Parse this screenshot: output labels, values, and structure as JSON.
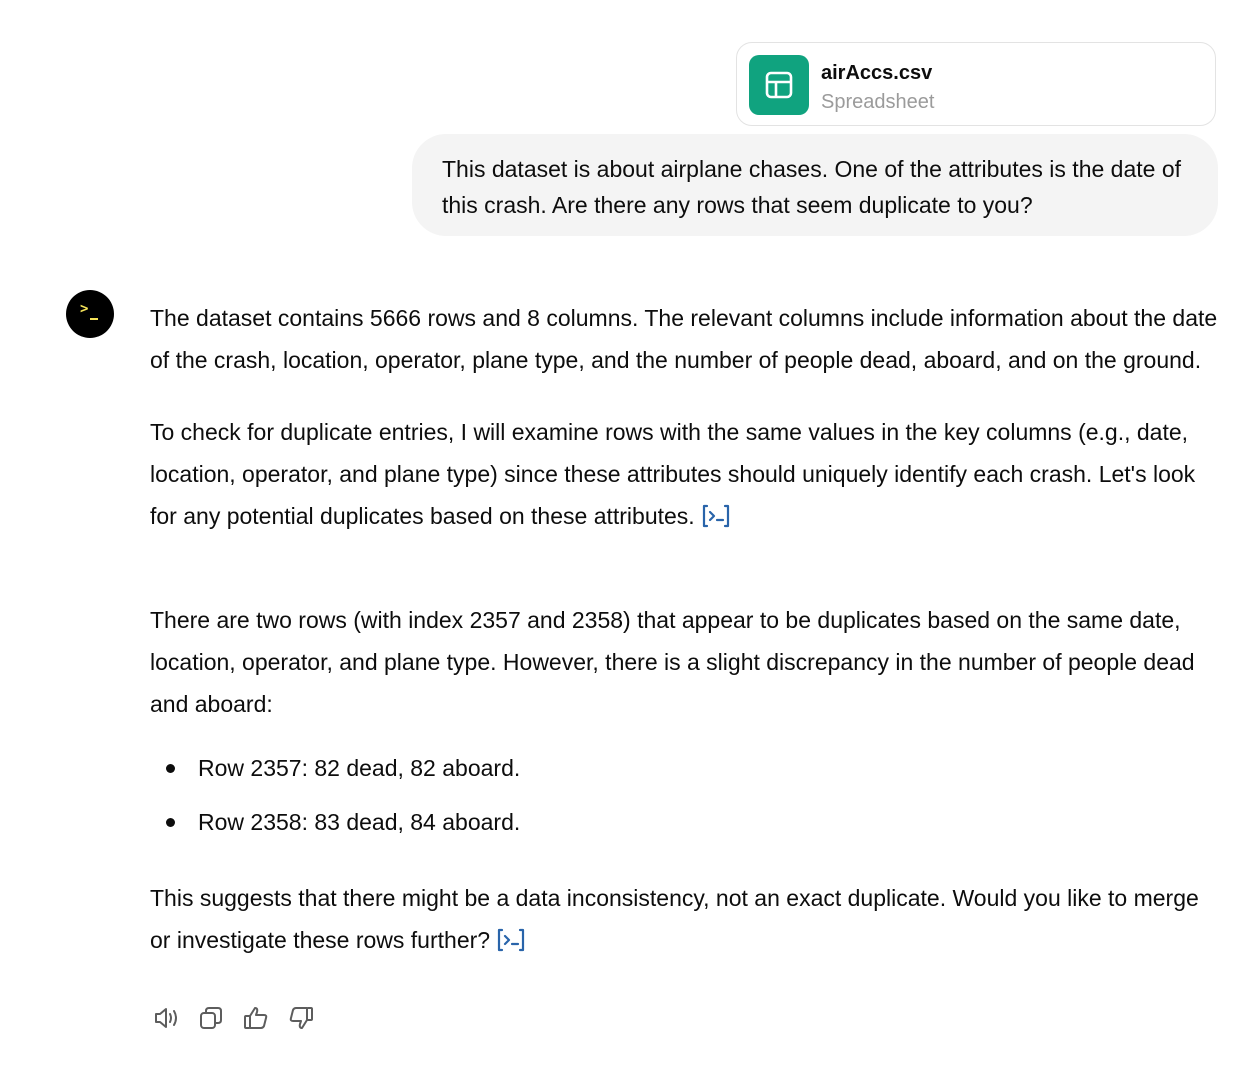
{
  "attachment": {
    "file_name": "airAccs.csv",
    "file_type": "Spreadsheet",
    "icon": "table-icon",
    "icon_color": "#10a37f"
  },
  "user_message": {
    "text": "This dataset is about airplane chases. One of the attributes is the date of this crash. Are there any rows that seem duplicate to you?"
  },
  "assistant": {
    "avatar_icon": "terminal-prompt-icon",
    "paragraphs": [
      "The dataset contains 5666 rows and 8 columns. The relevant columns include information about the date of the crash, location, operator, plane type, and the number of people dead, aboard, and on the ground.",
      "To check for duplicate entries, I will examine rows with the same values in the key columns (e.g., date, location, operator, and plane type) since these attributes should uniquely identify each crash. Let's look for any potential duplicates based on these attributes.",
      "There are two rows (with index 2357 and 2358) that appear to be duplicates based on the same date, location, operator, and plane type. However, there is a slight discrepancy in the number of people dead and aboard:"
    ],
    "bullets": [
      "Row 2357: 82 dead, 82 aboard.",
      "Row 2358: 83 dead, 84 aboard."
    ],
    "closing": "This suggests that there might be a data inconsistency, not an exact duplicate. Would you like to merge or investigate these rows further?",
    "code_link_icon": "view-analysis-icon",
    "link_color": "#2964aa"
  },
  "actions": [
    {
      "name": "read-aloud",
      "icon": "speaker-icon"
    },
    {
      "name": "copy",
      "icon": "copy-icon"
    },
    {
      "name": "good-response",
      "icon": "thumbs-up-icon"
    },
    {
      "name": "bad-response",
      "icon": "thumbs-down-icon"
    }
  ]
}
